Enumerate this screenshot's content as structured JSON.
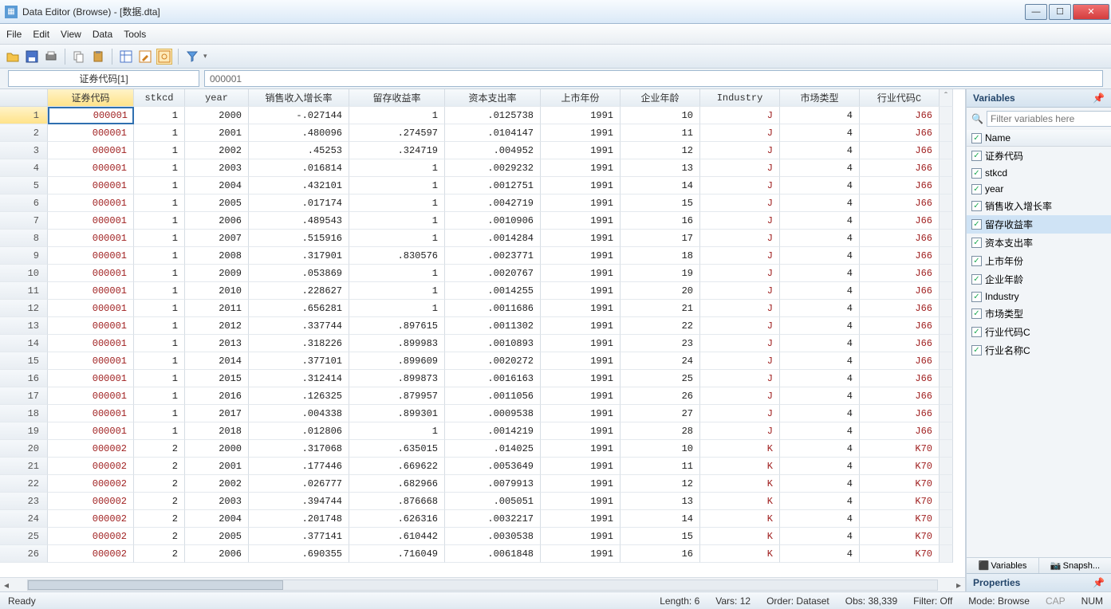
{
  "window": {
    "title": "Data Editor (Browse) - [数据.dta]"
  },
  "menu": {
    "file": "File",
    "edit": "Edit",
    "view": "View",
    "data": "Data",
    "tools": "Tools"
  },
  "address": {
    "cell": "证券代码[1]",
    "value": "000001"
  },
  "columns": [
    "证券代码",
    "stkcd",
    "year",
    "销售收入增长率",
    "留存收益率",
    "资本支出率",
    "上市年份",
    "企业年龄",
    "Industry",
    "市场类型",
    "行业代码C"
  ],
  "red_cols": [
    0,
    8,
    10
  ],
  "rows": [
    [
      "000001",
      "1",
      "2000",
      "-.027144",
      "1",
      ".0125738",
      "1991",
      "10",
      "J",
      "4",
      "J66"
    ],
    [
      "000001",
      "1",
      "2001",
      ".480096",
      ".274597",
      ".0104147",
      "1991",
      "11",
      "J",
      "4",
      "J66"
    ],
    [
      "000001",
      "1",
      "2002",
      ".45253",
      ".324719",
      ".004952",
      "1991",
      "12",
      "J",
      "4",
      "J66"
    ],
    [
      "000001",
      "1",
      "2003",
      ".016814",
      "1",
      ".0029232",
      "1991",
      "13",
      "J",
      "4",
      "J66"
    ],
    [
      "000001",
      "1",
      "2004",
      ".432101",
      "1",
      ".0012751",
      "1991",
      "14",
      "J",
      "4",
      "J66"
    ],
    [
      "000001",
      "1",
      "2005",
      ".017174",
      "1",
      ".0042719",
      "1991",
      "15",
      "J",
      "4",
      "J66"
    ],
    [
      "000001",
      "1",
      "2006",
      ".489543",
      "1",
      ".0010906",
      "1991",
      "16",
      "J",
      "4",
      "J66"
    ],
    [
      "000001",
      "1",
      "2007",
      ".515916",
      "1",
      ".0014284",
      "1991",
      "17",
      "J",
      "4",
      "J66"
    ],
    [
      "000001",
      "1",
      "2008",
      ".317901",
      ".830576",
      ".0023771",
      "1991",
      "18",
      "J",
      "4",
      "J66"
    ],
    [
      "000001",
      "1",
      "2009",
      ".053869",
      "1",
      ".0020767",
      "1991",
      "19",
      "J",
      "4",
      "J66"
    ],
    [
      "000001",
      "1",
      "2010",
      ".228627",
      "1",
      ".0014255",
      "1991",
      "20",
      "J",
      "4",
      "J66"
    ],
    [
      "000001",
      "1",
      "2011",
      ".656281",
      "1",
      ".0011686",
      "1991",
      "21",
      "J",
      "4",
      "J66"
    ],
    [
      "000001",
      "1",
      "2012",
      ".337744",
      ".897615",
      ".0011302",
      "1991",
      "22",
      "J",
      "4",
      "J66"
    ],
    [
      "000001",
      "1",
      "2013",
      ".318226",
      ".899983",
      ".0010893",
      "1991",
      "23",
      "J",
      "4",
      "J66"
    ],
    [
      "000001",
      "1",
      "2014",
      ".377101",
      ".899609",
      ".0020272",
      "1991",
      "24",
      "J",
      "4",
      "J66"
    ],
    [
      "000001",
      "1",
      "2015",
      ".312414",
      ".899873",
      ".0016163",
      "1991",
      "25",
      "J",
      "4",
      "J66"
    ],
    [
      "000001",
      "1",
      "2016",
      ".126325",
      ".879957",
      ".0011056",
      "1991",
      "26",
      "J",
      "4",
      "J66"
    ],
    [
      "000001",
      "1",
      "2017",
      ".004338",
      ".899301",
      ".0009538",
      "1991",
      "27",
      "J",
      "4",
      "J66"
    ],
    [
      "000001",
      "1",
      "2018",
      ".012806",
      "1",
      ".0014219",
      "1991",
      "28",
      "J",
      "4",
      "J66"
    ],
    [
      "000002",
      "2",
      "2000",
      ".317068",
      ".635015",
      ".014025",
      "1991",
      "10",
      "K",
      "4",
      "K70"
    ],
    [
      "000002",
      "2",
      "2001",
      ".177446",
      ".669622",
      ".0053649",
      "1991",
      "11",
      "K",
      "4",
      "K70"
    ],
    [
      "000002",
      "2",
      "2002",
      ".026777",
      ".682966",
      ".0079913",
      "1991",
      "12",
      "K",
      "4",
      "K70"
    ],
    [
      "000002",
      "2",
      "2003",
      ".394744",
      ".876668",
      ".005051",
      "1991",
      "13",
      "K",
      "4",
      "K70"
    ],
    [
      "000002",
      "2",
      "2004",
      ".201748",
      ".626316",
      ".0032217",
      "1991",
      "14",
      "K",
      "4",
      "K70"
    ],
    [
      "000002",
      "2",
      "2005",
      ".377141",
      ".610442",
      ".0030538",
      "1991",
      "15",
      "K",
      "4",
      "K70"
    ],
    [
      "000002",
      "2",
      "2006",
      ".690355",
      ".716049",
      ".0061848",
      "1991",
      "16",
      "K",
      "4",
      "K70"
    ]
  ],
  "variables": {
    "title": "Variables",
    "filter_placeholder": "Filter variables here",
    "name_hdr": "Name",
    "items": [
      "证券代码",
      "stkcd",
      "year",
      "销售收入增长率",
      "留存收益率",
      "资本支出率",
      "上市年份",
      "企业年龄",
      "Industry",
      "市场类型",
      "行业代码C",
      "行业名称C"
    ],
    "selected_index": 4,
    "tabs": {
      "vars": "Variables",
      "snap": "Snapsh..."
    }
  },
  "properties": {
    "title": "Properties"
  },
  "status": {
    "ready": "Ready",
    "length": "Length: 6",
    "vars": "Vars: 12",
    "order": "Order: Dataset",
    "obs": "Obs: 38,339",
    "filter": "Filter: Off",
    "mode": "Mode: Browse",
    "cap": "CAP",
    "num": "NUM"
  }
}
